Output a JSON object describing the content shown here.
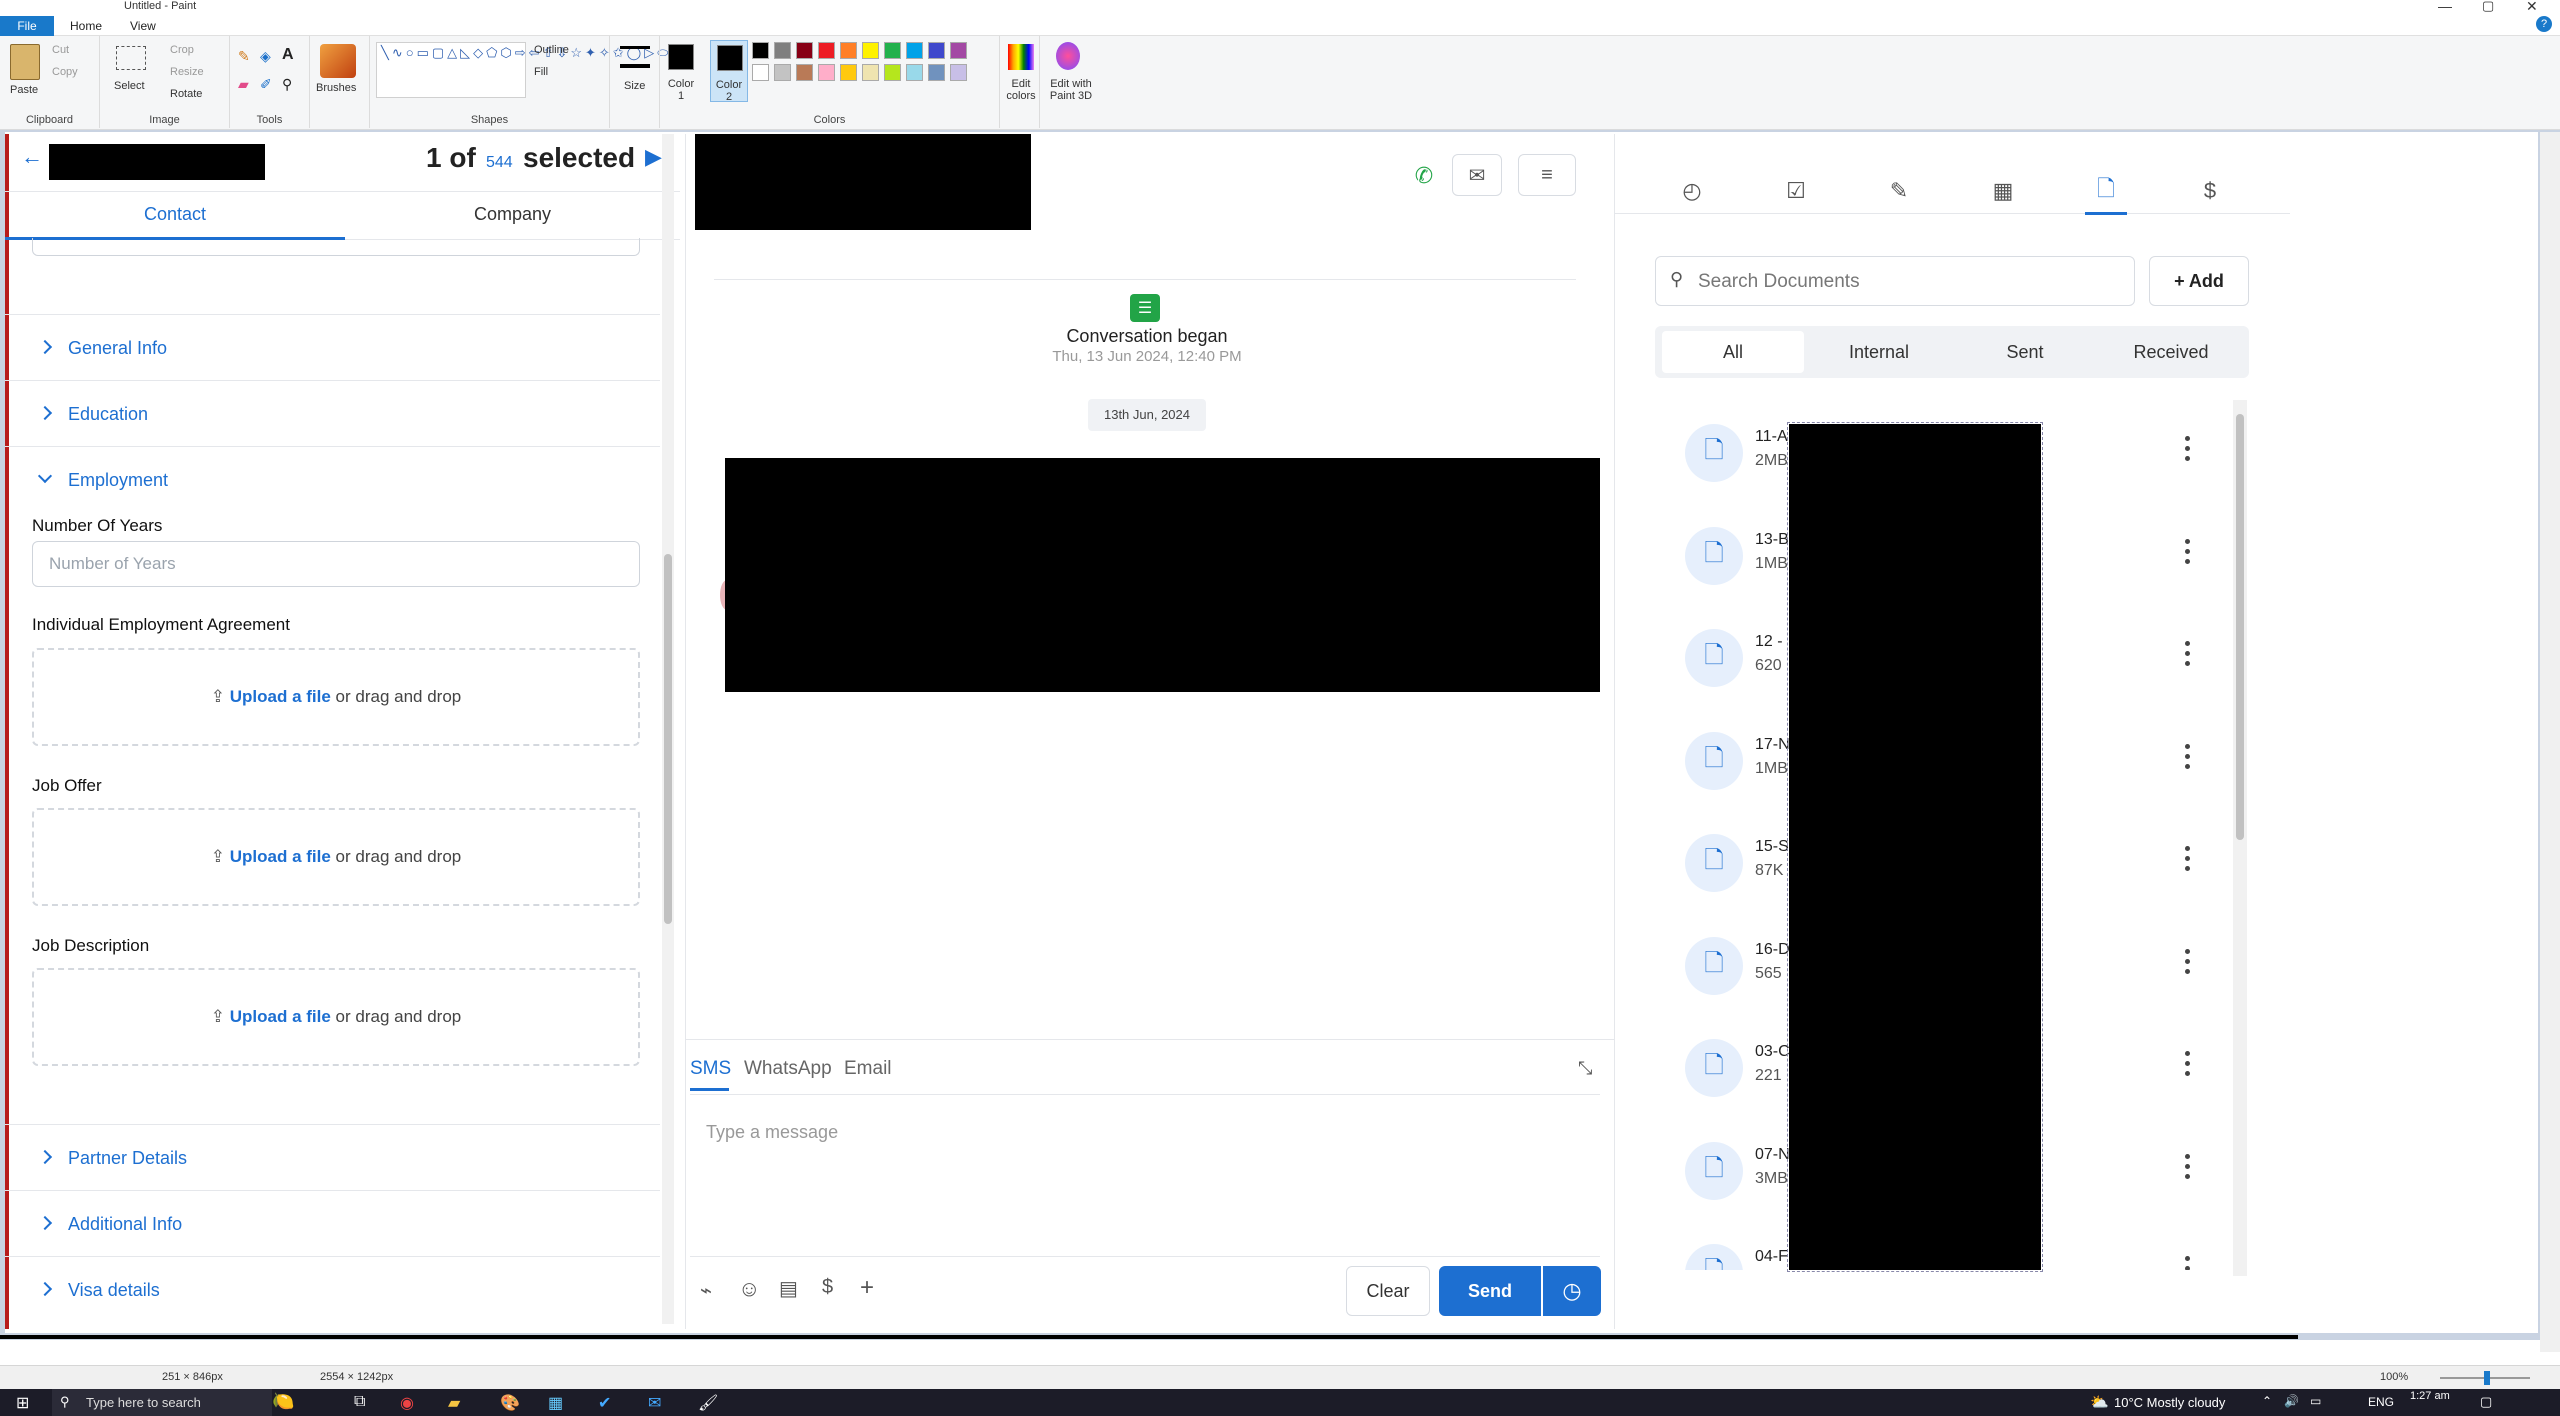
{
  "paint": {
    "title": "Untitled - Paint",
    "menu": [
      "File",
      "Home",
      "View"
    ],
    "groups": {
      "clipboard": {
        "caption": "Clipboard",
        "paste": "Paste",
        "cut": "Cut",
        "copy": "Copy"
      },
      "image": {
        "caption": "Image",
        "select": "Select",
        "crop": "Crop",
        "resize": "Resize",
        "rotate": "Rotate"
      },
      "tools": {
        "caption": "Tools"
      },
      "brushes": {
        "label": "Brushes"
      },
      "shapes": {
        "caption": "Shapes",
        "outline": "Outline",
        "fill": "Fill"
      },
      "size": {
        "label": "Size"
      },
      "colors": {
        "caption": "Colors",
        "color1": "Color 1",
        "color2": "Color 2",
        "edit": "Edit colors",
        "paint3d": "Edit with Paint 3D"
      }
    },
    "palette": [
      "#000000",
      "#7f7f7f",
      "#880015",
      "#ed1c24",
      "#ff7f27",
      "#fff200",
      "#22b14c",
      "#00a2e8",
      "#3f48cc",
      "#a349a4",
      "#ffffff",
      "#c3c3c3",
      "#b97a57",
      "#ffaec9",
      "#ffc90e",
      "#efe4b0",
      "#b5e61d",
      "#99d9ea",
      "#7092be",
      "#c8bfe7"
    ],
    "status": {
      "selection": "251 × 846px",
      "canvas": "2554 × 1242px",
      "zoom": "100%"
    }
  },
  "taskbar": {
    "search": "Type here to search",
    "weather": "10°C  Mostly cloudy",
    "lang": "ENG",
    "time": "1:27 am"
  },
  "left": {
    "pager": {
      "current": "1 of",
      "total": "544",
      "selected": "selected"
    },
    "tabs": [
      "Contact",
      "Company"
    ],
    "sections": {
      "general": "General Info",
      "education": "Education",
      "employment": "Employment",
      "partner": "Partner Details",
      "additional": "Additional Info",
      "visa": "Visa details"
    },
    "fields": {
      "years_label": "Number Of Years",
      "years_placeholder": "Number of Years",
      "agreement_label": "Individual Employment Agreement",
      "offer_label": "Job Offer",
      "description_label": "Job Description",
      "upload_link": "Upload a file",
      "upload_rest": " or drag and drop"
    }
  },
  "middle": {
    "conversation_began": "Conversation began",
    "began_time": "Thu, 13 Jun 2024, 12:40 PM",
    "date_chip": "13th Jun, 2024",
    "channels": [
      "SMS",
      "WhatsApp",
      "Email"
    ],
    "placeholder": "Type a message",
    "clear": "Clear",
    "send": "Send"
  },
  "right": {
    "search_placeholder": "Search Documents",
    "add": "Add",
    "filters": [
      "All",
      "Internal",
      "Sent",
      "Received"
    ],
    "docs": [
      {
        "name": "11-A",
        "size": "2MB"
      },
      {
        "name": "13-B",
        "size": "1MB"
      },
      {
        "name": "12 -",
        "size": "620"
      },
      {
        "name": "17-N",
        "size": "1MB"
      },
      {
        "name": "15-S",
        "size": "87K"
      },
      {
        "name": "16-D",
        "size": "565"
      },
      {
        "name": "03-C",
        "size": "221"
      },
      {
        "name": "07-N",
        "size": "3MB"
      },
      {
        "name": "04-F",
        "size": ""
      }
    ]
  }
}
